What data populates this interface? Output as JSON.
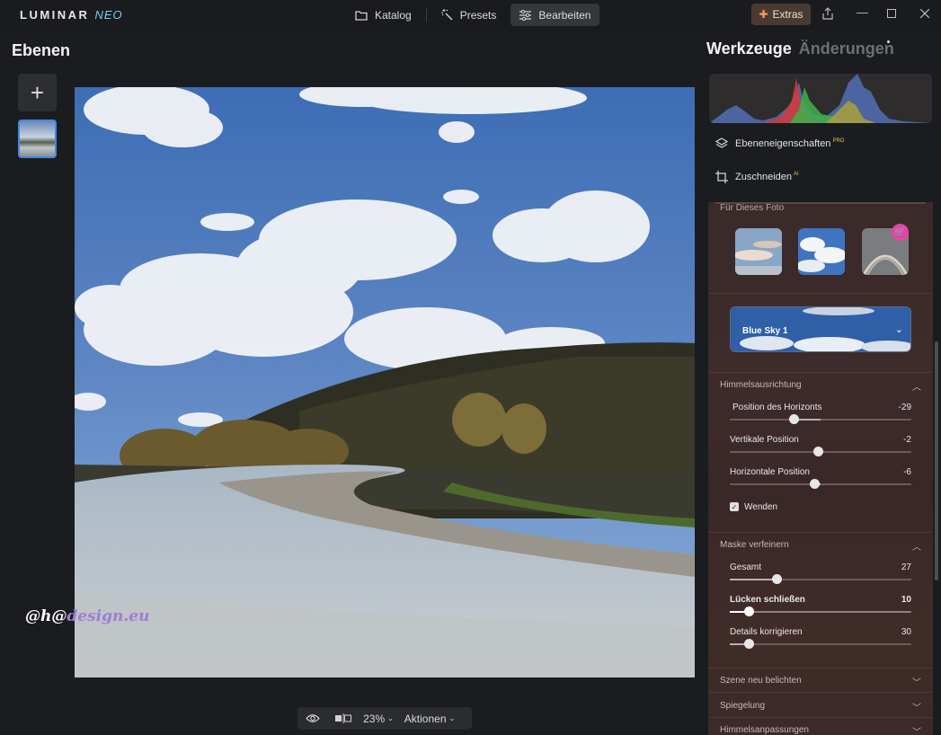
{
  "app": {
    "logo_main": "LUMINAR",
    "logo_sub": "NEO"
  },
  "topnav": {
    "items": [
      {
        "label": "Katalog",
        "icon": "folder-icon"
      },
      {
        "label": "Presets",
        "icon": "magic-wand-icon"
      },
      {
        "label": "Bearbeiten",
        "icon": "sliders-icon",
        "active": true
      }
    ],
    "extras_label": "Extras"
  },
  "layers": {
    "title": "Ebenen",
    "add_label": "+"
  },
  "watermark": {
    "part1": "@h@",
    "part2": "design.eu"
  },
  "bottombar": {
    "zoom": "23%",
    "actions": "Aktionen"
  },
  "tools": {
    "tab_active": "Werkzeuge",
    "tab_inactive": "Änderungen",
    "layer_props": "Ebeneneigenschaften",
    "layer_props_badge": "PRO",
    "crop": "Zuschneiden",
    "crop_badge": "AI"
  },
  "sky": {
    "for_photo": "Für Dieses Foto",
    "selected_sky": "Blue Sky 1"
  },
  "section_orientation": {
    "title": "Himmelsausrichtung",
    "sliders": [
      {
        "label": "Position des Horizonts",
        "value": "-29",
        "pos": 0.35
      },
      {
        "label": "Vertikale Position",
        "value": "-2",
        "pos": 0.49
      },
      {
        "label": "Horizontale Position",
        "value": "-6",
        "pos": 0.47
      }
    ],
    "flip_label": "Wenden",
    "flip_checked": true
  },
  "section_mask": {
    "title": "Maske verfeinern",
    "sliders": [
      {
        "label": "Gesamt",
        "value": "27",
        "pos": 0.27
      },
      {
        "label": "Lücken schließen",
        "value": "10",
        "pos": 0.1
      },
      {
        "label": "Details korrigieren",
        "value": "30",
        "pos": 0.1
      }
    ]
  },
  "collapsed_sections": [
    {
      "title": "Szene neu belichten"
    },
    {
      "title": "Spiegelung"
    },
    {
      "title": "Himmelsanpassungen"
    }
  ]
}
